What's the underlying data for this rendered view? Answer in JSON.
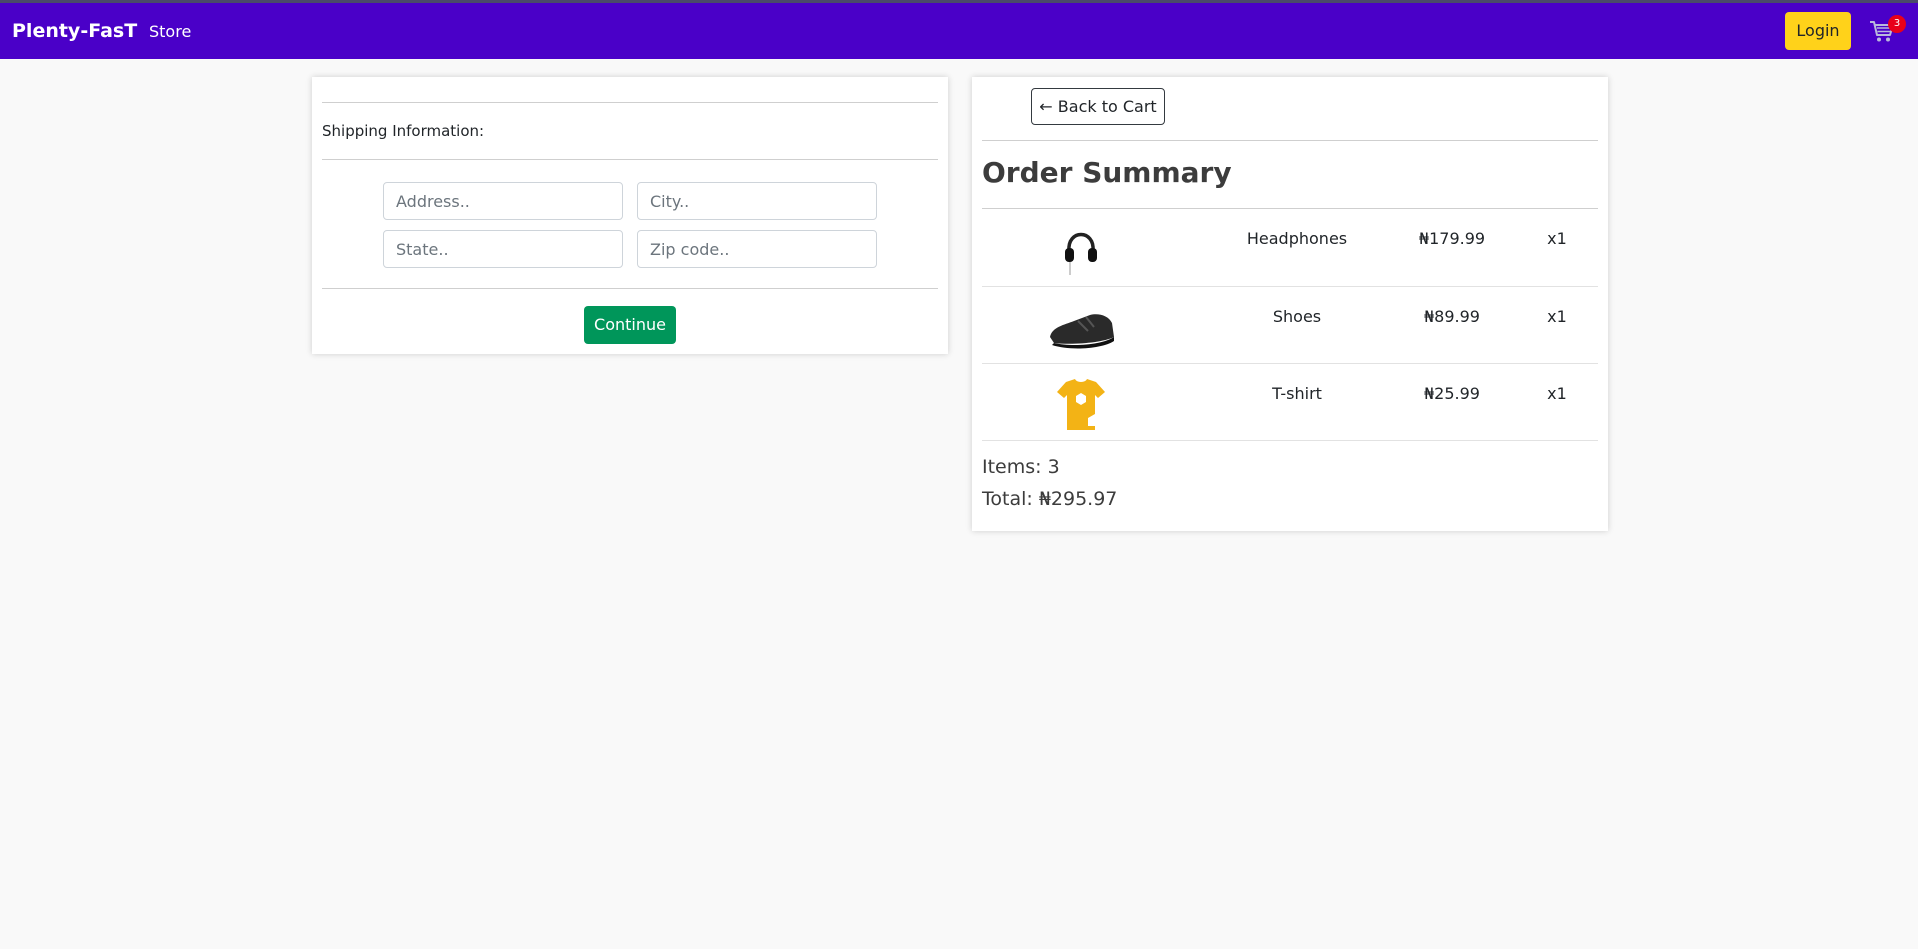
{
  "navbar": {
    "brand": "Plenty-FasT",
    "store_link": "Store",
    "login_label": "Login",
    "cart_count": "3",
    "cart_icon": "cart-icon"
  },
  "shipping": {
    "heading": "Shipping Information:",
    "address_placeholder": "Address..",
    "city_placeholder": "City..",
    "state_placeholder": "State..",
    "zip_placeholder": "Zip code..",
    "address_value": "",
    "city_value": "",
    "state_value": "",
    "zip_value": "",
    "continue_label": "Continue"
  },
  "summary": {
    "back_label": "← Back to Cart",
    "title": "Order Summary",
    "items": [
      {
        "name": "Headphones",
        "price": "₦179.99",
        "qty": "x1",
        "image_icon": "headphones-image"
      },
      {
        "name": "Shoes",
        "price": "₦89.99",
        "qty": "x1",
        "image_icon": "shoes-image"
      },
      {
        "name": "T-shirt",
        "price": "₦25.99",
        "qty": "x1",
        "image_icon": "tshirt-image"
      }
    ],
    "items_text": "Items: 3",
    "total_text": "Total: ₦295.97"
  },
  "colors": {
    "navbar_bg": "#4a00c8",
    "login_bg": "#ffd21a",
    "continue_bg": "#00965a",
    "badge_bg": "#e8001a"
  }
}
